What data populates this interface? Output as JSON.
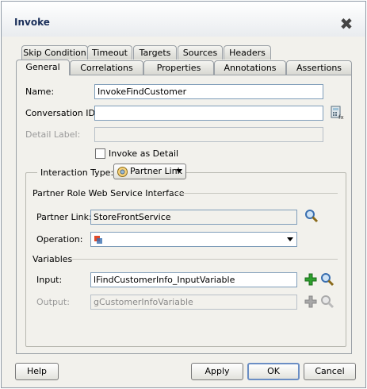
{
  "window": {
    "title": "Invoke"
  },
  "tabs_row1": [
    {
      "label": "Skip Condition"
    },
    {
      "label": "Timeout"
    },
    {
      "label": "Targets"
    },
    {
      "label": "Sources"
    },
    {
      "label": "Headers"
    }
  ],
  "tabs_row2": [
    {
      "label": "General",
      "active": true
    },
    {
      "label": "Correlations"
    },
    {
      "label": "Properties"
    },
    {
      "label": "Annotations"
    },
    {
      "label": "Assertions"
    }
  ],
  "general": {
    "name_label": "Name:",
    "name_value": "InvokeFindCustomer",
    "conversation_label": "Conversation ID:",
    "conversation_value": "",
    "detail_label": "Detail Label:",
    "detail_value": "",
    "invoke_as_detail_label": "Invoke as Detail",
    "invoke_as_detail_checked": false
  },
  "interaction": {
    "label": "Interaction Type:",
    "value": "Partner Link"
  },
  "partner_role": {
    "title": "Partner Role Web Service Interface",
    "partner_link_label": "Partner Link:",
    "partner_link_value": "StoreFrontService",
    "operation_label": "Operation:",
    "operation_value": ""
  },
  "variables": {
    "title": "Variables",
    "input_label": "Input:",
    "input_value": "lFindCustomerInfo_InputVariable",
    "output_label": "Output:",
    "output_value": "gCustomerInfoVariable"
  },
  "footer": {
    "help": "Help",
    "apply": "Apply",
    "ok": "OK",
    "cancel": "Cancel"
  },
  "colors": {
    "title": "#1a2f5a",
    "add_icon": "#2ea12e",
    "search_icon": "#3a6fb0"
  }
}
